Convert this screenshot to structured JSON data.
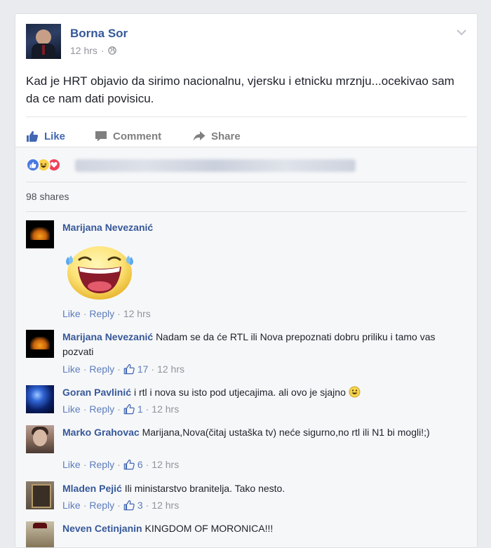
{
  "post": {
    "author": "Borna Sor",
    "time": "12 hrs",
    "audience_icon": "globe-icon",
    "text": "Kad je HRT objavio da sirimo nacionalnu, vjersku i etnicku mrznju...ocekivao sam da ce nam dati povisicu.",
    "actions": {
      "like": "Like",
      "comment": "Comment",
      "share": "Share"
    },
    "reactions": [
      "like",
      "haha",
      "love"
    ],
    "shares": "98 shares"
  },
  "ui": {
    "sep": "·",
    "like": "Like",
    "reply": "Reply"
  },
  "comments": [
    {
      "author": "Marijana Nevezanić",
      "text": "",
      "sticker": "laughing-face-sticker",
      "likes": "",
      "time": "12 hrs"
    },
    {
      "author": "Marijana Nevezanić",
      "text": "Nadam se da će RTL ili Nova prepoznati dobru priliku i tamo vas pozvati",
      "likes": "17",
      "time": "12 hrs"
    },
    {
      "author": "Goran Pavlinić",
      "text": "i rtl i nova su isto pod utjecajima. ali ovo je sjajno",
      "emoji": "smiley-icon",
      "likes": "1",
      "time": "12 hrs"
    },
    {
      "author": "Marko Grahovac",
      "text": "Marijana,Nova(čitaj ustaška tv) neće sigurno,no rtl ili N1 bi mogli!;)",
      "likes": "6",
      "time": "12 hrs"
    },
    {
      "author": "Mladen Pejić",
      "text": "Ili ministarstvo branitelja. Tako nesto.",
      "likes": "3",
      "time": "12 hrs"
    },
    {
      "author": "Neven Cetinjanin",
      "text": "KINGDOM OF MORONICA!!!",
      "likes": "",
      "time": ""
    }
  ],
  "colors": {
    "link": "#365899",
    "like_blue": "#4267b2",
    "muted": "#90949c",
    "background": "#e9ebee"
  }
}
